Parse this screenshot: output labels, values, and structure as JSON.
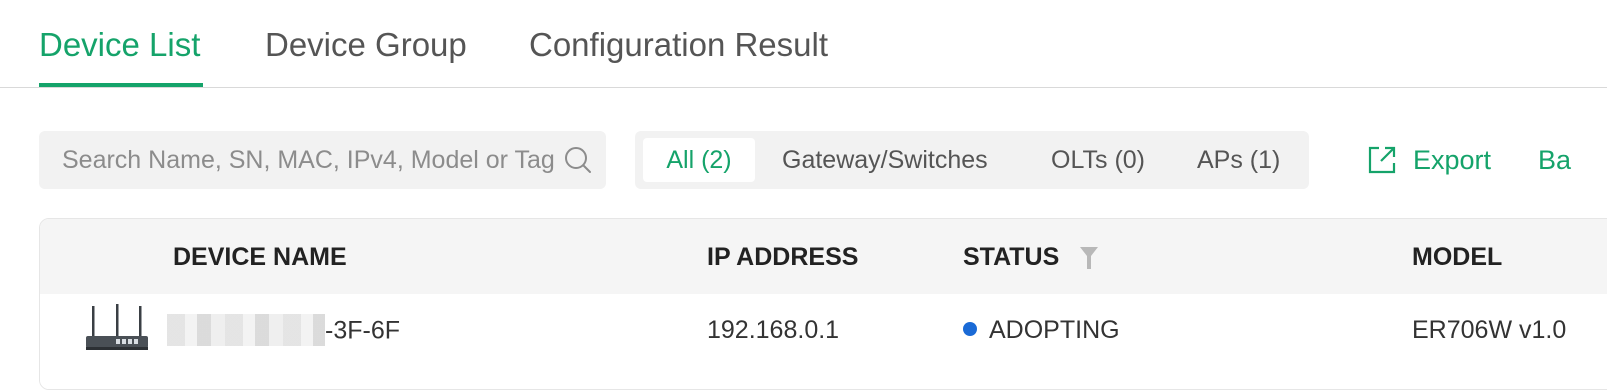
{
  "tabs": [
    {
      "label": "Device List",
      "active": true
    },
    {
      "label": "Device Group",
      "active": false
    },
    {
      "label": "Configuration Result",
      "active": false
    }
  ],
  "search": {
    "placeholder": "Search Name, SN, MAC, IPv4, Model or Tag",
    "icon": "search-icon"
  },
  "filters": [
    {
      "label": "All (2)",
      "active": true
    },
    {
      "label": "Gateway/Switches",
      "active": false
    },
    {
      "label": "OLTs (0)",
      "active": false
    },
    {
      "label": "APs (1)",
      "active": false
    }
  ],
  "actions": {
    "export_label": "Export",
    "export_icon": "external-link-icon",
    "batch_label": "Ba"
  },
  "table": {
    "headers": {
      "device_name": "DEVICE NAME",
      "ip_address": "IP ADDRESS",
      "status": "STATUS",
      "model": "MODEL"
    },
    "rows": [
      {
        "device_name_suffix": "-3F-6F",
        "ip_address": "192.168.0.1",
        "status": "ADOPTING",
        "model": "ER706W v1.0",
        "icon": "router-icon"
      }
    ]
  },
  "colors": {
    "accent": "#15a36a",
    "status_adopting": "#1a6ad6"
  }
}
